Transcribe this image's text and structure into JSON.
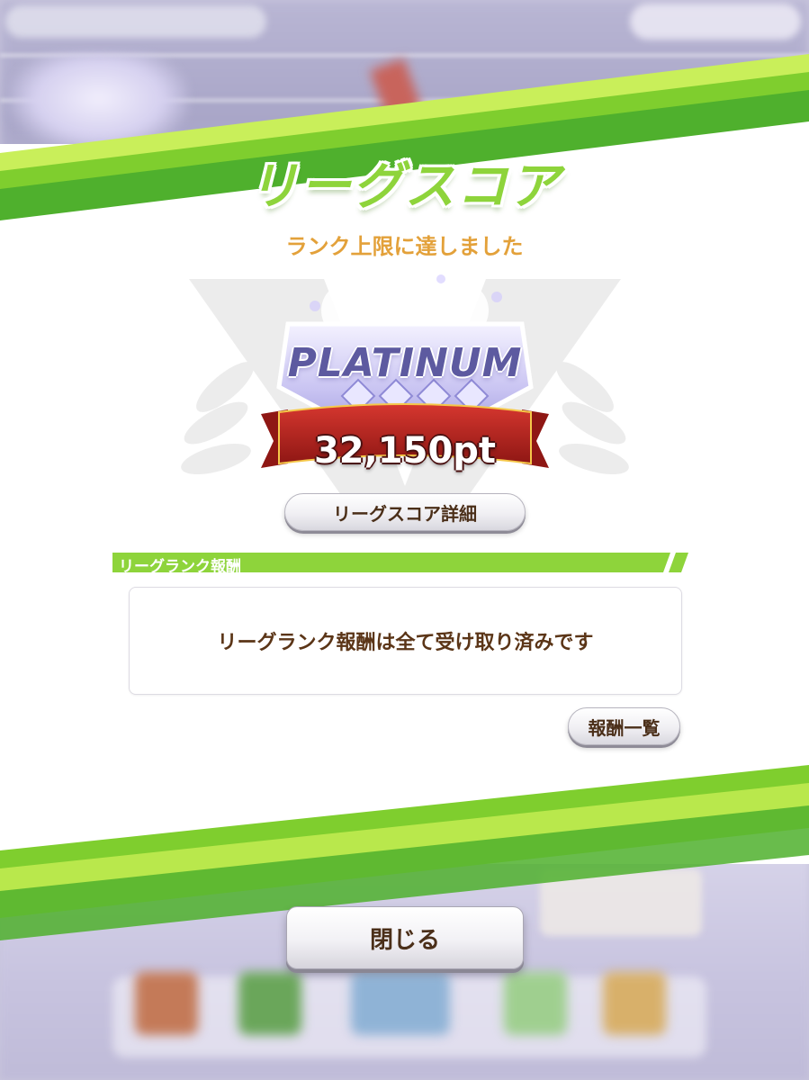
{
  "dialog": {
    "title": "リーグスコア",
    "subtitle": "ランク上限に達しました",
    "rank_name": "PLATINUM",
    "score": "32,150pt",
    "detail_button": "リーグスコア詳細",
    "section_header": "リーグランク報酬",
    "reward_message": "リーグランク報酬は全て受け取り済みです",
    "rewards_list_button": "報酬一覧",
    "close_button": "閉じる"
  },
  "colors": {
    "accent_green": "#8ed43b",
    "subtitle_orange": "#e3a13a",
    "text_brown": "#5b3517",
    "ribbon_red": "#b8241f",
    "badge_purple": "#8f8ad6"
  }
}
